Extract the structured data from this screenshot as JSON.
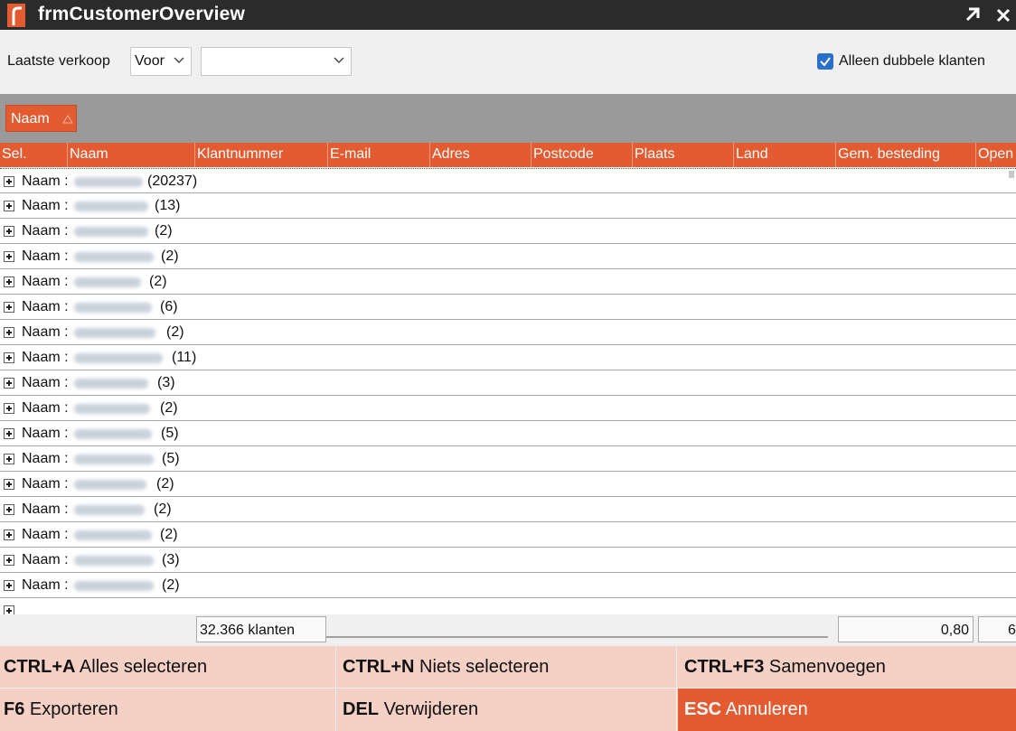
{
  "window": {
    "title": "frmCustomerOverview"
  },
  "filter": {
    "laatste_label": "Laatste verkoop",
    "operator_value": "Voor",
    "date_value": "",
    "duplicates_checkbox": {
      "label": "Alleen dubbele klanten",
      "checked": true
    }
  },
  "group_panel": {
    "chip_label": "Naam"
  },
  "columns": [
    "Sel.",
    "Naam",
    "Klantnummer",
    "E-mail",
    "Adres",
    "Postcode",
    "Plaats",
    "Land",
    "Gem. besteding",
    "Open"
  ],
  "rows": [
    {
      "label": "Naam :",
      "count": "(20237)"
    },
    {
      "label": "Naam :",
      "count": "(13)"
    },
    {
      "label": "Naam :",
      "count": "(2)"
    },
    {
      "label": "Naam :",
      "count": "(2)"
    },
    {
      "label": "Naam :",
      "count": "(2)"
    },
    {
      "label": "Naam :",
      "count": "(6)"
    },
    {
      "label": "Naam :",
      "count": "(2)"
    },
    {
      "label": "Naam :",
      "count": "(11)"
    },
    {
      "label": "Naam :",
      "count": "(3)"
    },
    {
      "label": "Naam :",
      "count": "(2)"
    },
    {
      "label": "Naam :",
      "count": "(5)"
    },
    {
      "label": "Naam :",
      "count": "(5)"
    },
    {
      "label": "Naam :",
      "count": "(2)"
    },
    {
      "label": "Naam :",
      "count": "(2)"
    },
    {
      "label": "Naam :",
      "count": "(2)"
    },
    {
      "label": "Naam :",
      "count": "(3)"
    },
    {
      "label": "Naam :",
      "count": "(2)"
    }
  ],
  "summary": {
    "customer_count": "32.366 klanten",
    "avg_spend": "0,80",
    "open": "6"
  },
  "actions": [
    {
      "key": "CTRL+A",
      "label": "Alles selecteren"
    },
    {
      "key": "CTRL+N",
      "label": "Niets selecteren"
    },
    {
      "key": "CTRL+F3",
      "label": "Samenvoegen"
    },
    {
      "key": "F6",
      "label": "Exporteren"
    },
    {
      "key": "DEL",
      "label": "Verwijderen"
    },
    {
      "key": "ESC",
      "label": "Annuleren"
    }
  ],
  "colors": {
    "accent": "#e35b31",
    "title_bar": "#2b2b2b",
    "button_bg": "#f5d0c4",
    "group_panel": "#9a9a9a"
  },
  "icons": {
    "app": "app-logo-icon",
    "restore": "maximize-arrow-icon",
    "close": "close-icon",
    "chevron": "chevron-down-icon",
    "sort": "sort-ascending-icon",
    "expand": "plus-expand-icon",
    "check": "checkmark-icon"
  }
}
